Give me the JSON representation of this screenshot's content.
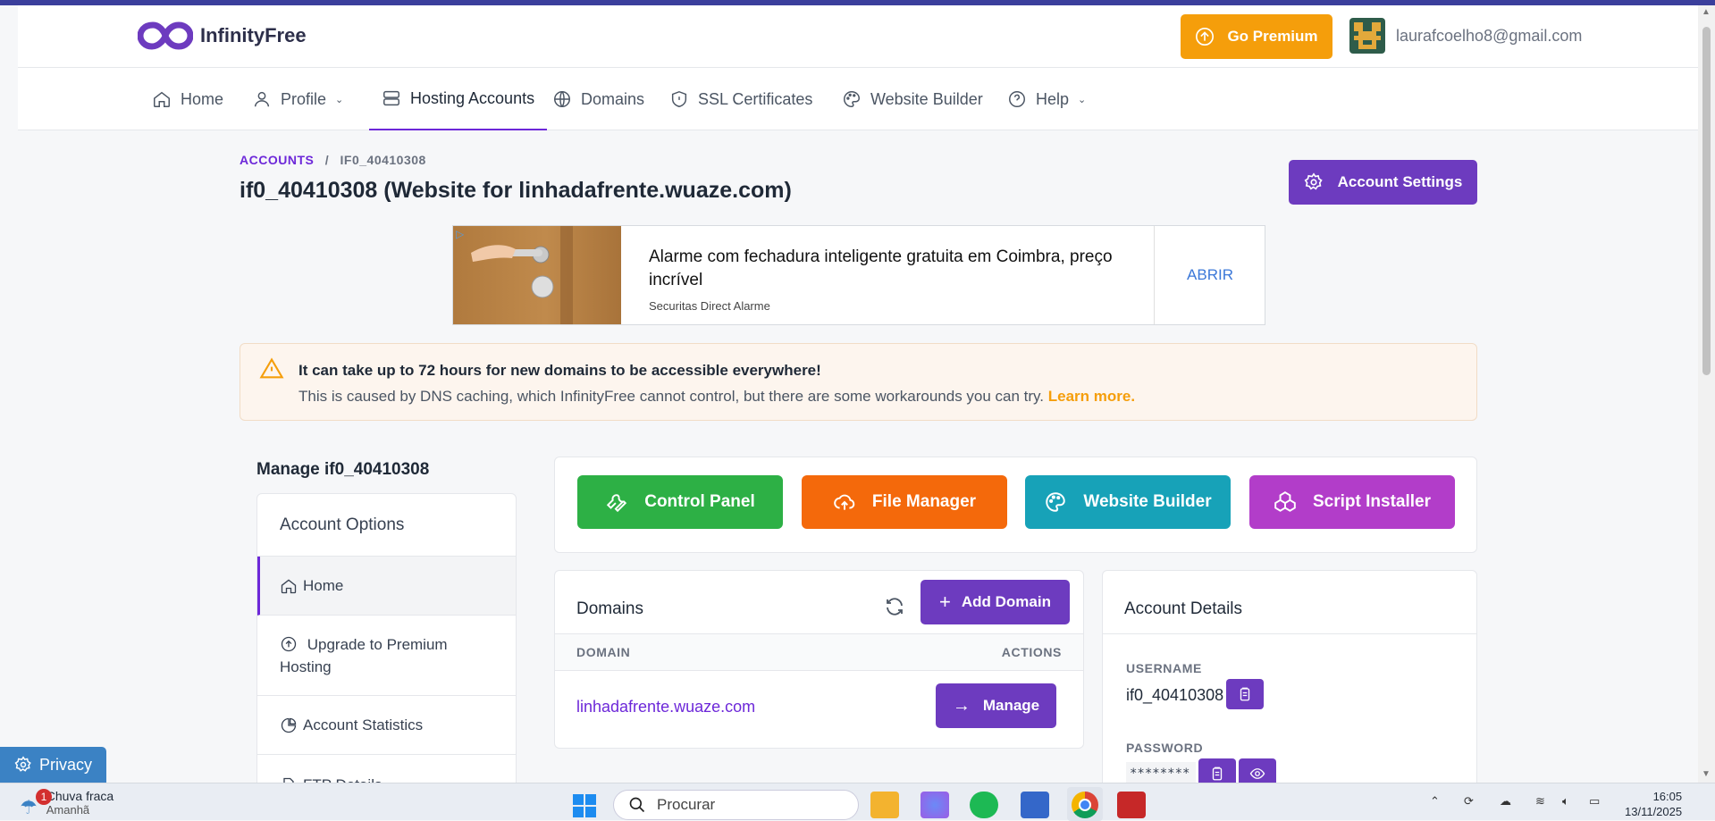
{
  "brand": {
    "name": "InfinityFree",
    "accent": "#6d28d9",
    "premium_color": "#f59e0b"
  },
  "header": {
    "premium_label": "Go Premium",
    "user_email": "laurafcoelho8@gmail.com"
  },
  "nav": {
    "items": [
      {
        "label": "Home"
      },
      {
        "label": "Profile"
      },
      {
        "label": "Hosting Accounts"
      },
      {
        "label": "Domains"
      },
      {
        "label": "SSL Certificates"
      },
      {
        "label": "Website Builder"
      },
      {
        "label": "Help"
      }
    ]
  },
  "breadcrumb": {
    "root": "ACCOUNTS",
    "sep": "/",
    "current": "IF0_40410308"
  },
  "page": {
    "title": "if0_40410308 (Website for linhadafrente.wuaze.com)",
    "settings_label": "Account Settings"
  },
  "ad": {
    "title": "Alarme com fechadura inteligente gratuita em Coimbra, preço incrível",
    "advertiser": "Securitas Direct Alarme",
    "cta": "ABRIR"
  },
  "alert": {
    "title": "It can take up to 72 hours for new domains to be accessible everywhere!",
    "text": "This is caused by DNS caching, which InfinityFree cannot control, but there are some workarounds you can try.",
    "link": "Learn more."
  },
  "sidebar": {
    "manage_title": "Manage if0_40410308",
    "heading": "Account Options",
    "items": [
      {
        "label": "Home"
      },
      {
        "label": "Upgrade to Premium Hosting"
      },
      {
        "label": "Account Statistics"
      },
      {
        "label": "FTP Details"
      }
    ]
  },
  "tools": {
    "items": [
      {
        "label": "Control Panel",
        "color": "#2db045"
      },
      {
        "label": "File Manager",
        "color": "#f4690b"
      },
      {
        "label": "Website Builder",
        "color": "#17a2b8"
      },
      {
        "label": "Script Installer",
        "color": "#b23dc9"
      }
    ]
  },
  "domains": {
    "title": "Domains",
    "add_label": "Add Domain",
    "columns": [
      "DOMAIN",
      "ACTIONS"
    ],
    "rows": [
      {
        "domain": "linhadafrente.wuaze.com",
        "action": "Manage"
      }
    ]
  },
  "details": {
    "title": "Account Details",
    "username_label": "USERNAME",
    "username": "if0_40410308",
    "password_label": "PASSWORD",
    "password": "********"
  },
  "privacy": {
    "label": "Privacy"
  },
  "taskbar": {
    "weather_line1": "Chuva fraca",
    "weather_line2": "Amanhã",
    "badge": "1",
    "search_placeholder": "Procurar",
    "time": "16:05",
    "date": "13/11/2025"
  }
}
